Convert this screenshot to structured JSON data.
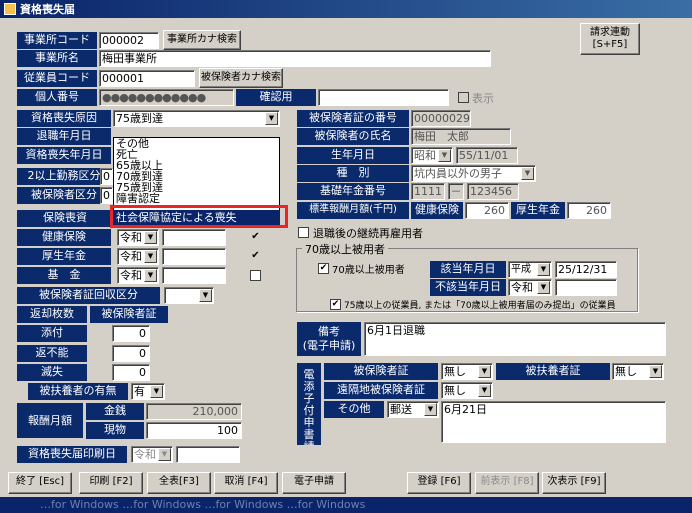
{
  "window": {
    "title": "資格喪失届"
  },
  "header": {
    "office_code_label": "事業所コード",
    "office_code": "000002",
    "office_kana_search": "事業所カナ検索",
    "office_name_label": "事業所名",
    "office_name": "梅田事業所",
    "employee_code_label": "従業員コード",
    "employee_code": "000001",
    "insured_kana_search": "被保険者カナ検索",
    "personal_no_label": "個人番号",
    "personal_no": "●●●●●●●●●●●●",
    "confirm_label": "確認用",
    "show_label": "表示",
    "request_button": "請求連動\n[S+F5]"
  },
  "left": {
    "reason_label": "資格喪失原因",
    "reason_value": "75歳到達",
    "retire_label": "退職年月日",
    "loss_date_label": "資格喪失年月日",
    "two_over70_label": "2以上勤務区分",
    "two_over70_value": "0",
    "insured_cat_label": "被保険者区分",
    "insured_cat_value": "0",
    "dropdown_items": [
      "その他",
      "死亡",
      "65歳以上",
      "70歳到達",
      "75歳到達",
      "障害認定",
      "社会保障協定による喪失"
    ],
    "insurance_label": "保険喪資",
    "health_label": "健康保険",
    "pension_label": "厚生年金",
    "fund_label": "基　金",
    "era": "令和",
    "cert_collect_label": "被保険者証回収区分",
    "return_count_label": "返却枚数",
    "insured_cert_label": "被保険者証",
    "attached_label": "添付",
    "attached_value": "0",
    "unreturnable_label": "返不能",
    "unreturnable_value": "0",
    "lost_label": "滅失",
    "lost_value": "0",
    "dependent_label": "被扶養者の有無",
    "dependent_value": "有",
    "salary_label": "報酬月額",
    "money_label": "金銭",
    "money_value": "210,000",
    "goods_label": "現物",
    "goods_value": "100",
    "print_date_label": "資格喪失届印刷日",
    "print_era": "令和"
  },
  "right": {
    "cert_no_label": "被保険者証の番号",
    "cert_no": "00000029",
    "name_label": "被保険者の氏名",
    "name": "梅田　太郎",
    "birth_label": "生年月日",
    "birth_era": "昭和",
    "birth_date": "55/11/01",
    "type_label": "種　別",
    "type_value": "坑内員以外の男子",
    "pension_no_label": "基礎年金番号",
    "pension_no_a": "1111",
    "pension_no_dash": "－",
    "pension_no_b": "123456",
    "std_salary_label": "標準報酬月額(千円)",
    "health_ins_label": "健康保険",
    "health_ins_value": "260",
    "welfare_label": "厚生年金",
    "welfare_value": "260",
    "rehire_label": "退職後の継続再雇用者",
    "over70_group": "70歳以上被用者",
    "over70_label": "70歳以上被用者",
    "applicable_date_label": "該当年月日",
    "applicable_era": "平成",
    "applicable_date": "25/12/31",
    "not_applicable_label": "不該当年月日",
    "not_applicable_era": "令和",
    "over70_note": "75歳以上の従業員, または「70歳以上被用者届のみ提出」の従業員",
    "remarks_label": "備考\n(電子申請)",
    "remarks_value": "6月1日退職",
    "attach_side_label": "電添子付申書請類",
    "insured_cert2_label": "被保険者証",
    "insured_cert2_value": "無し",
    "dependent_cert_label": "被扶養者証",
    "dependent_cert_value": "無し",
    "remote_label": "遠隔地被保険者証",
    "remote_value": "無し",
    "other_label": "その他",
    "other_value": "郵送",
    "other_note": "6月21日"
  },
  "footer": {
    "end": "終了 [Esc]",
    "print": "印刷 [F2]",
    "display_all": "全表[F3]",
    "cancel": "取消 [F4]",
    "e_apply": "電子申請",
    "register": "登録 [F6]",
    "prev": "前表示 [F8]",
    "next": "次表示 [F9]"
  },
  "status": {
    "text": "…for Windows      …for Windows      …for Windows      …for Windows"
  },
  "colors": {
    "label_bg": "#0a2a6c",
    "highlight_border": "#e8262a",
    "window_bg": "#d4d0c8"
  }
}
